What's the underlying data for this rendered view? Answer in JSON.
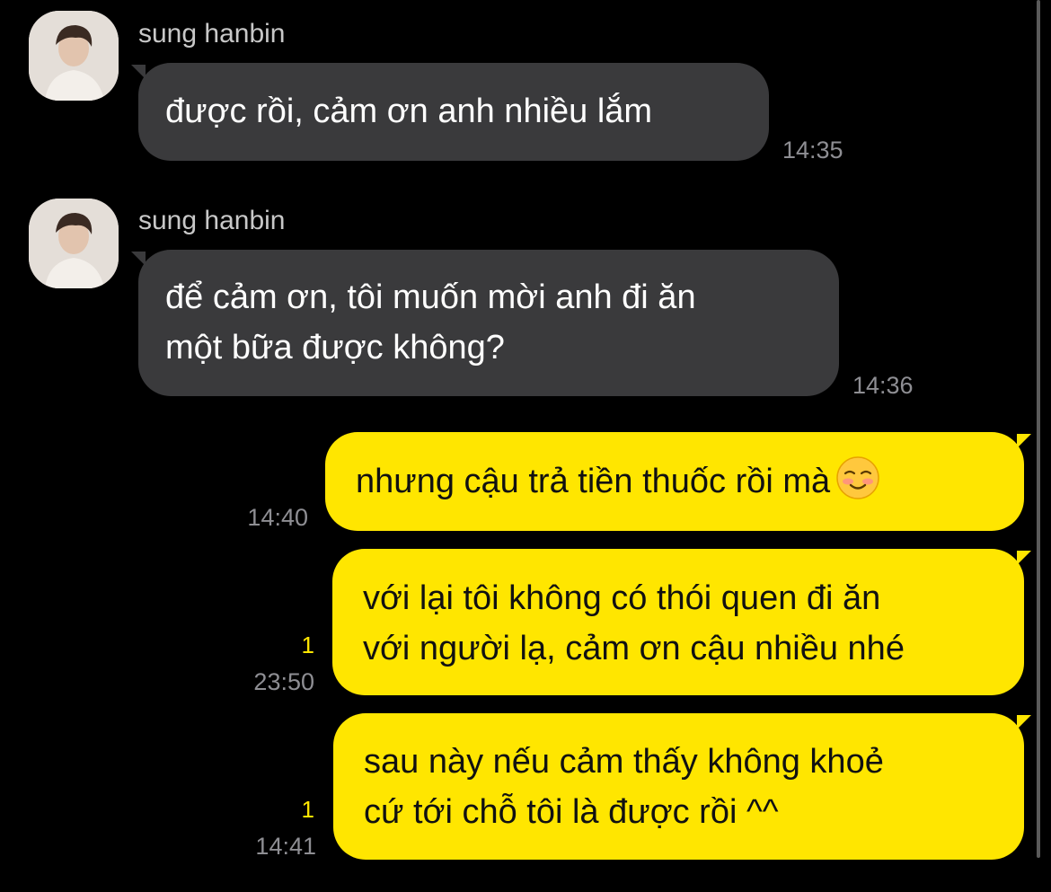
{
  "chat": {
    "messages": [
      {
        "direction": "incoming",
        "sender": "sung hanbin",
        "lines": [
          "được rồi, cảm ơn anh nhiều lắm"
        ],
        "time": "14:35"
      },
      {
        "direction": "incoming",
        "sender": "sung hanbin",
        "lines": [
          "để cảm ơn, tôi muốn mời anh đi ăn",
          "một bữa được không?"
        ],
        "time": "14:36"
      },
      {
        "direction": "outgoing",
        "lines": [
          "nhưng cậu trả tiền thuốc rồi mà"
        ],
        "emoji": "smiling-blush-emoji",
        "time": "14:40"
      },
      {
        "direction": "outgoing",
        "lines": [
          "với lại tôi không có thói quen đi ăn",
          "với người lạ, cảm ơn cậu nhiều nhé"
        ],
        "unread": "1",
        "time": "23:50"
      },
      {
        "direction": "outgoing",
        "lines": [
          "sau này nếu cảm thấy không khoẻ",
          "cứ tới chỗ tôi là được rồi ^^"
        ],
        "unread": "1",
        "time": "14:41"
      }
    ]
  },
  "colors": {
    "background": "#000000",
    "incoming_bubble": "#3a3a3c",
    "outgoing_bubble": "#ffe600",
    "unread_badge": "#ffe600",
    "timestamp": "#8e8e93"
  },
  "icons": {
    "avatar": "profile-photo",
    "emoji": "smiling-blush-emoji"
  }
}
